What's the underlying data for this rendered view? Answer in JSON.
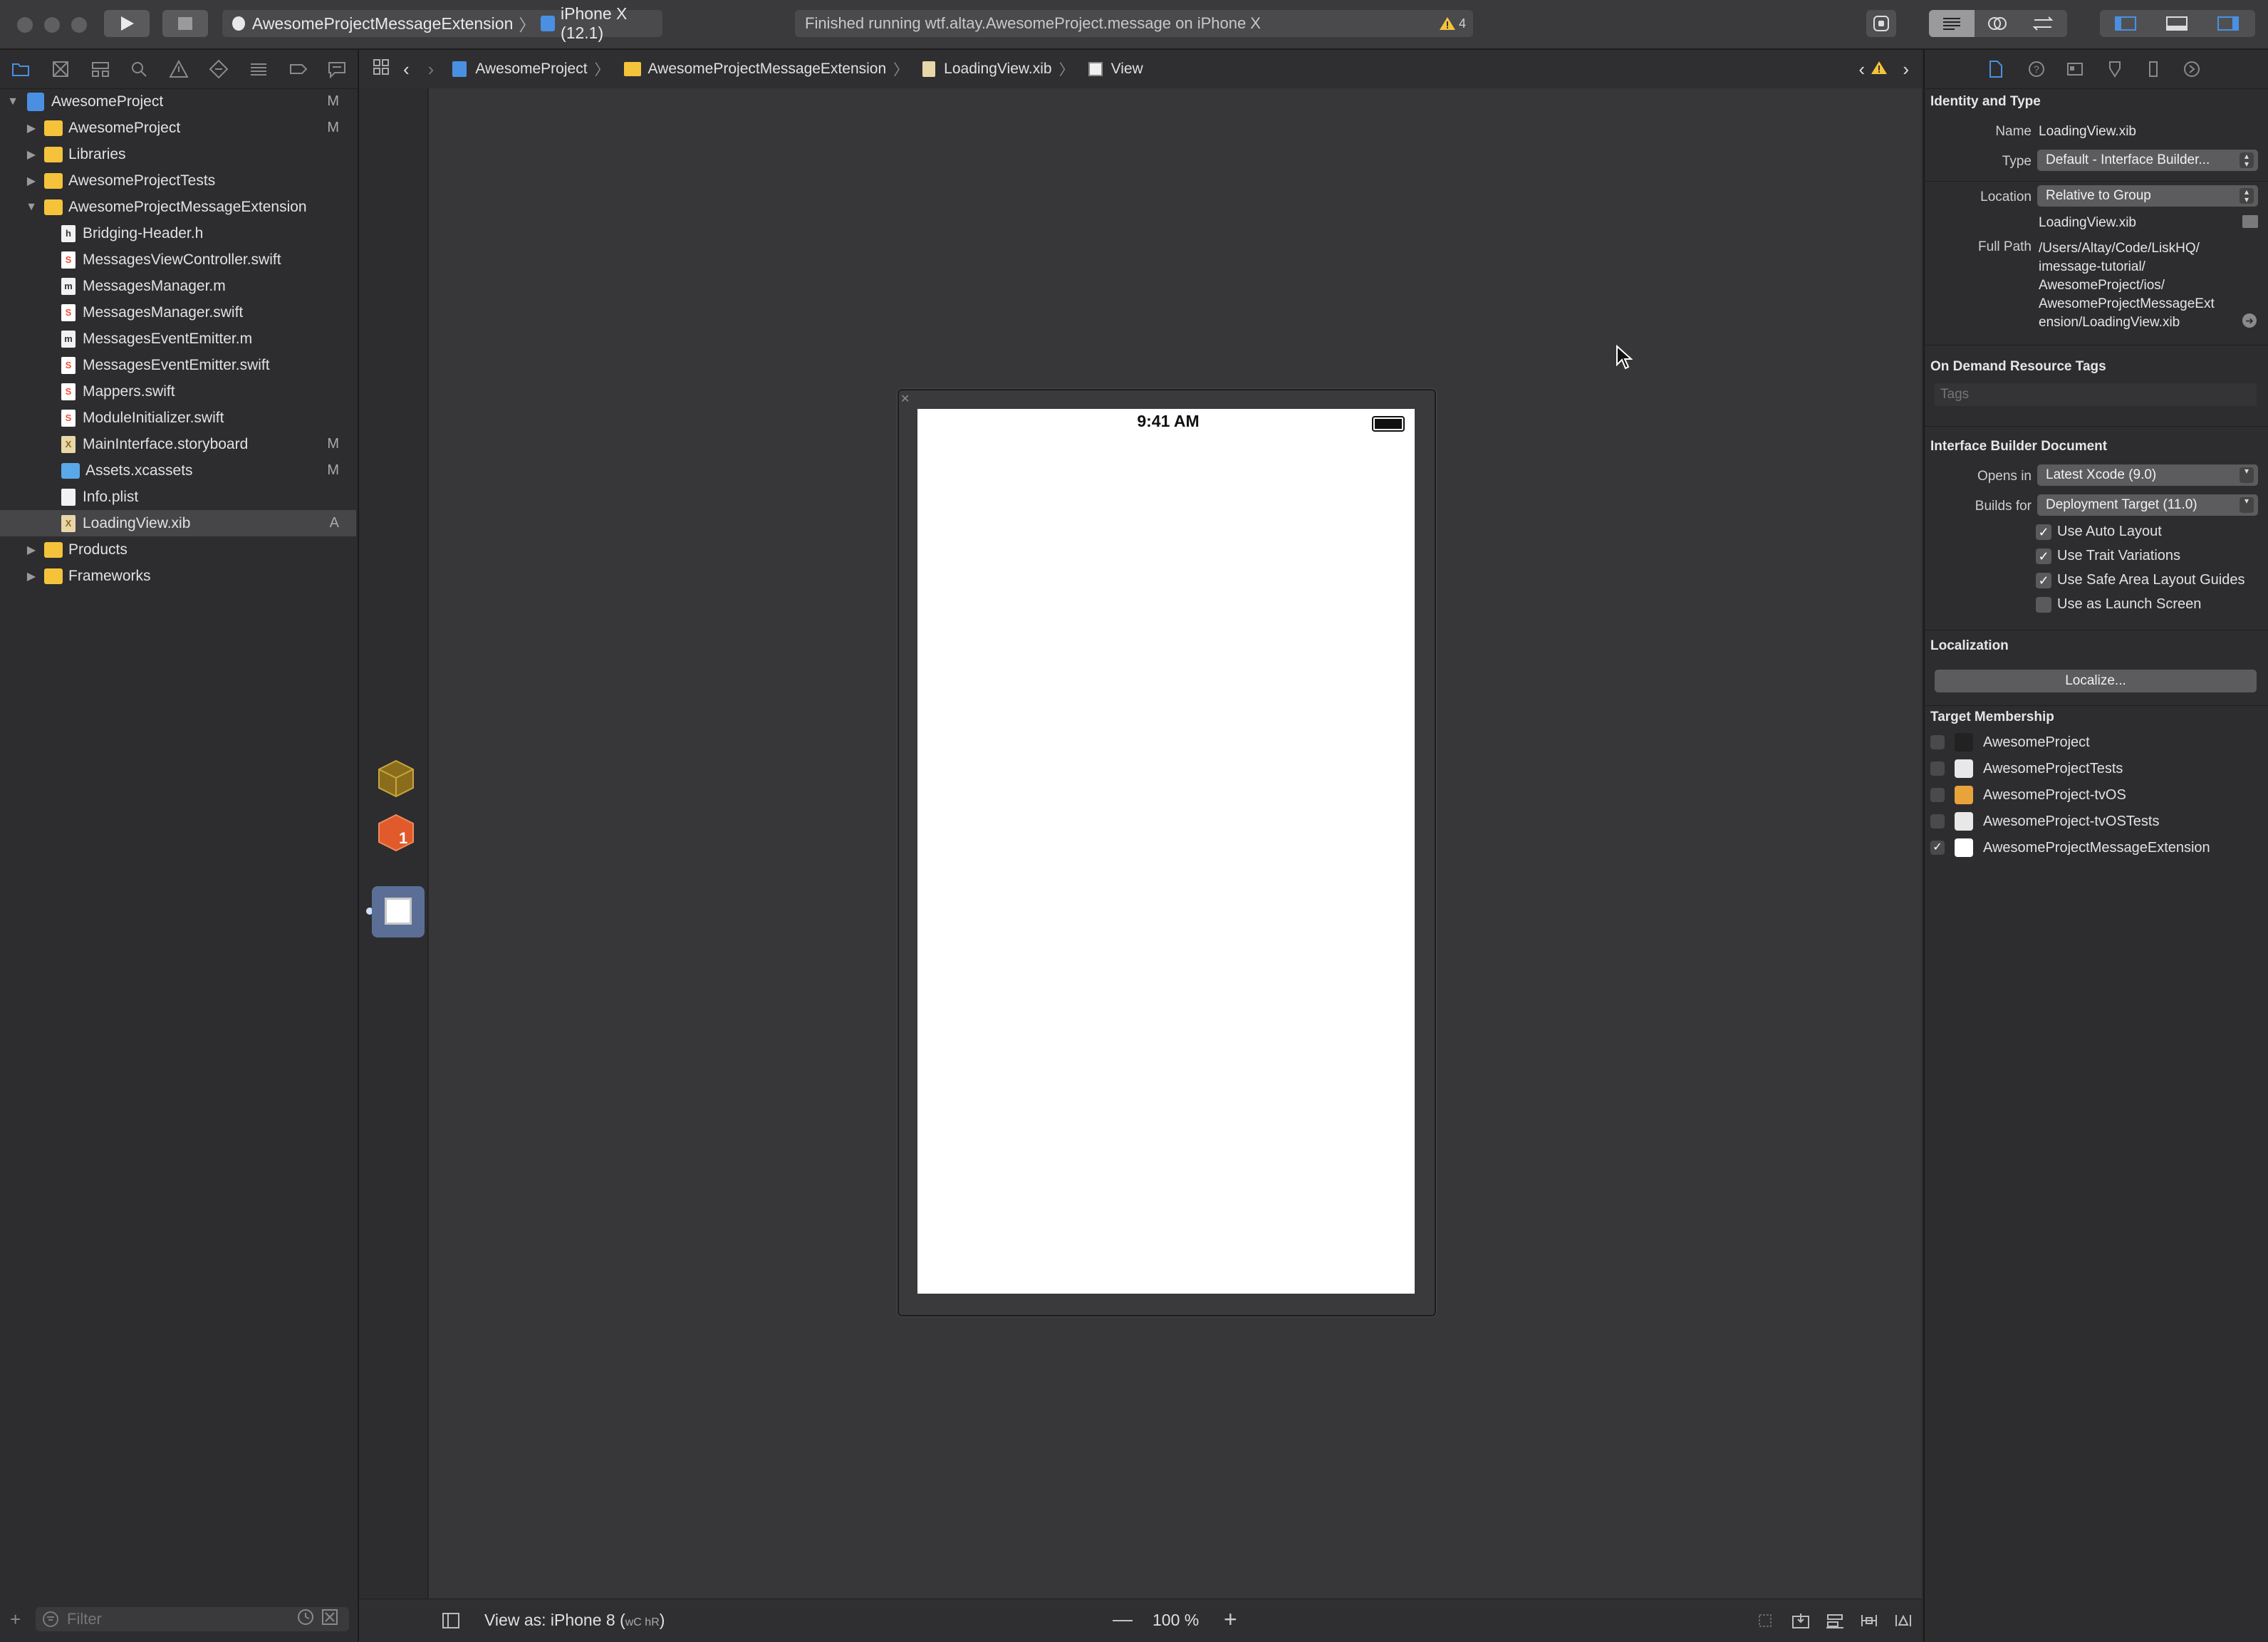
{
  "toolbar": {
    "scheme_target": "AwesomeProjectMessageExtension",
    "scheme_device": "iPhone X (12.1)",
    "activity_status": "Finished running wtf.altay.AwesomeProject.message on iPhone X",
    "warning_count": "4"
  },
  "navigator": {
    "project_name": "AwesomeProject",
    "project_status": "M",
    "items": [
      {
        "label": "AwesomeProject",
        "kind": "folder",
        "status": "M",
        "depth": 1,
        "disclosure": "▶"
      },
      {
        "label": "Libraries",
        "kind": "folder",
        "status": "",
        "depth": 1,
        "disclosure": "▶"
      },
      {
        "label": "AwesomeProjectTests",
        "kind": "folder",
        "status": "",
        "depth": 1,
        "disclosure": "▶"
      },
      {
        "label": "AwesomeProjectMessageExtension",
        "kind": "folder",
        "status": "",
        "depth": 1,
        "disclosure": "▼"
      },
      {
        "label": "Bridging-Header.h",
        "kind": "h",
        "status": "",
        "depth": 2
      },
      {
        "label": "MessagesViewController.swift",
        "kind": "swift",
        "status": "",
        "depth": 2
      },
      {
        "label": "MessagesManager.m",
        "kind": "m",
        "status": "",
        "depth": 2
      },
      {
        "label": "MessagesManager.swift",
        "kind": "swift",
        "status": "",
        "depth": 2
      },
      {
        "label": "MessagesEventEmitter.m",
        "kind": "m",
        "status": "",
        "depth": 2
      },
      {
        "label": "MessagesEventEmitter.swift",
        "kind": "swift",
        "status": "",
        "depth": 2
      },
      {
        "label": "Mappers.swift",
        "kind": "swift",
        "status": "",
        "depth": 2
      },
      {
        "label": "ModuleInitializer.swift",
        "kind": "swift",
        "status": "",
        "depth": 2
      },
      {
        "label": "MainInterface.storyboard",
        "kind": "xib",
        "status": "M",
        "depth": 2
      },
      {
        "label": "Assets.xcassets",
        "kind": "assets",
        "status": "M",
        "depth": 2
      },
      {
        "label": "Info.plist",
        "kind": "plist",
        "status": "",
        "depth": 2
      },
      {
        "label": "LoadingView.xib",
        "kind": "xib",
        "status": "A",
        "depth": 2,
        "selected": true
      },
      {
        "label": "Products",
        "kind": "folder",
        "status": "",
        "depth": 1,
        "disclosure": "▶"
      },
      {
        "label": "Frameworks",
        "kind": "folder",
        "status": "",
        "depth": 1,
        "disclosure": "▶"
      }
    ],
    "filter_placeholder": "Filter"
  },
  "jumpbar": {
    "crumbs": [
      "AwesomeProject",
      "AwesomeProjectMessageExtension",
      "LoadingView.xib",
      "View"
    ]
  },
  "canvas": {
    "status_time": "9:41 AM"
  },
  "bottombar": {
    "view_as": "View as: iPhone 8 (",
    "view_as_traits": "wC hR",
    "view_as_close": ")",
    "zoom": "100 %"
  },
  "inspector": {
    "identity_title": "Identity and Type",
    "name_label": "Name",
    "name_value": "LoadingView.xib",
    "type_label": "Type",
    "type_value": "Default - Interface Builder...",
    "location_label": "Location",
    "location_value": "Relative to Group",
    "location_file": "LoadingView.xib",
    "fullpath_label": "Full Path",
    "fullpath_lines": [
      "/Users/Altay/Code/LiskHQ/",
      "imessage-tutorial/",
      "AwesomeProject/ios/",
      "AwesomeProjectMessageExt",
      "ension/LoadingView.xib"
    ],
    "tags_title": "On Demand Resource Tags",
    "tags_placeholder": "Tags",
    "ib_title": "Interface Builder Document",
    "opens_label": "Opens in",
    "opens_value": "Latest Xcode (9.0)",
    "builds_label": "Builds for",
    "builds_value": "Deployment Target (11.0)",
    "checks": [
      {
        "label": "Use Auto Layout",
        "checked": true
      },
      {
        "label": "Use Trait Variations",
        "checked": true
      },
      {
        "label": "Use Safe Area Layout Guides",
        "checked": true
      },
      {
        "label": "Use as Launch Screen",
        "checked": false
      }
    ],
    "localization_title": "Localization",
    "localize_button": "Localize...",
    "membership_title": "Target Membership",
    "targets": [
      {
        "label": "AwesomeProject",
        "checked": false,
        "color": "#222222"
      },
      {
        "label": "AwesomeProjectTests",
        "checked": false,
        "color": "#e8e8e8"
      },
      {
        "label": "AwesomeProject-tvOS",
        "checked": false,
        "color": "#e8a33a"
      },
      {
        "label": "AwesomeProject-tvOSTests",
        "checked": false,
        "color": "#e8e8e8"
      },
      {
        "label": "AwesomeProjectMessageExtension",
        "checked": true,
        "color": "#ffffff"
      }
    ]
  },
  "colors": {
    "accent": "#4a90e2",
    "folder": "#f5c33b",
    "warning": "#f5c33b"
  }
}
